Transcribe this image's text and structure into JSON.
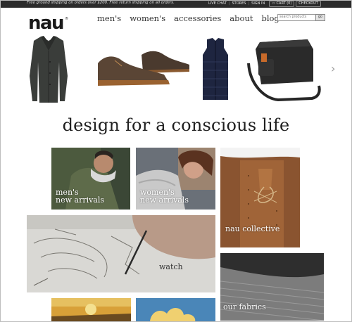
{
  "topbar": {
    "promo": "Free ground shipping on orders over $200. Free return shipping on all orders.",
    "live_chat": "LIVE CHAT",
    "stores": "STORES",
    "sign_in": "SIGN IN",
    "cart": "CART (0)",
    "checkout": "CHECKOUT"
  },
  "header": {
    "logo": "nau",
    "nav": [
      "men's",
      "women's",
      "accessories",
      "about",
      "blog"
    ],
    "search_placeholder": "search products",
    "search_button": "go"
  },
  "tagline": "design for a conscious life",
  "tiles": {
    "mens": [
      "men's",
      "new arrivals"
    ],
    "womens": [
      "women's",
      "new arrivals"
    ],
    "collective": "nau collective",
    "watch": "watch",
    "fabrics": "our fabrics"
  },
  "colors": {
    "topbar_bg": "#2b2b2b",
    "text": "#222222"
  }
}
